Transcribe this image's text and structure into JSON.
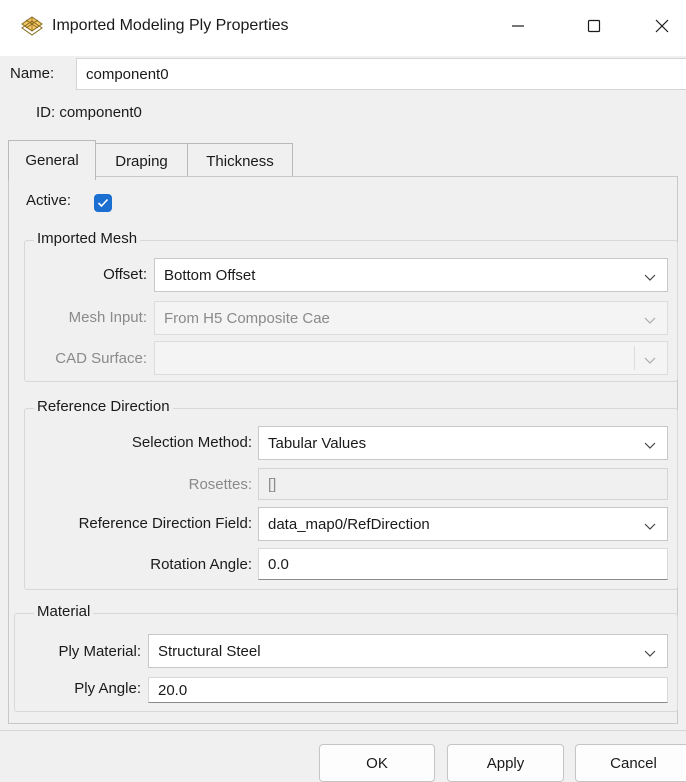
{
  "window": {
    "title": "Imported Modeling Ply Properties",
    "icon": "ply-stack-icon",
    "controls": [
      "minimize-icon",
      "maximize-icon",
      "close-icon"
    ]
  },
  "header": {
    "name_label": "Name:",
    "name_value": "component0",
    "id_text": "ID: component0"
  },
  "tabs": [
    {
      "label": "General",
      "active": true
    },
    {
      "label": "Draping",
      "active": false
    },
    {
      "label": "Thickness",
      "active": false
    }
  ],
  "general": {
    "active_label": "Active:",
    "active_checked": true,
    "imported_mesh": {
      "title": "Imported Mesh",
      "offset_label": "Offset:",
      "offset_value": "Bottom Offset",
      "mesh_input_label": "Mesh Input:",
      "mesh_input_value": "From H5 Composite Cae",
      "cad_surface_label": "CAD Surface:",
      "cad_surface_value": ""
    },
    "reference_direction": {
      "title": "Reference Direction",
      "selection_method_label": "Selection Method:",
      "selection_method_value": "Tabular Values",
      "rosettes_label": "Rosettes:",
      "rosettes_value": "[]",
      "field_label": "Reference Direction Field:",
      "field_value": "data_map0/RefDirection",
      "rotation_angle_label": "Rotation Angle:",
      "rotation_angle_value": "0.0"
    },
    "material": {
      "title": "Material",
      "ply_material_label": "Ply Material:",
      "ply_material_value": "Structural Steel",
      "ply_angle_label": "Ply Angle:",
      "ply_angle_value": "20.0"
    }
  },
  "footer": {
    "ok_label": "OK",
    "apply_label": "Apply",
    "cancel_label": "Cancel"
  },
  "colors": {
    "accent": "#1a6fd0",
    "disabled_text": "#8a8a8a"
  }
}
